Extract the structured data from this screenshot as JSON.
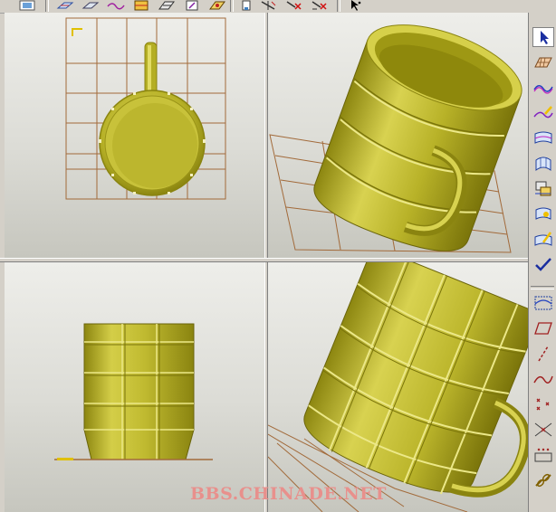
{
  "toolbar": {
    "icons": [
      "view-settings-icon",
      "wireframe-surface-icon",
      "curve-icon",
      "shaded-surface-icon",
      "sweep-surface-icon",
      "sketch-icon",
      "surface-edit-icon",
      "point-icon",
      "trim-icon",
      "delete-icon",
      "delete-all-icon",
      "select-cursor-icon"
    ]
  },
  "viewports": [
    {
      "name": "top-view",
      "view": "top"
    },
    {
      "name": "isometric-view-upper",
      "view": "isometric"
    },
    {
      "name": "front-view",
      "view": "front"
    },
    {
      "name": "isometric-view-lower",
      "view": "isometric"
    }
  ],
  "rightbar": {
    "upper_tools": [
      "select-arrow-icon",
      "plane-icon",
      "curve-wave-icon",
      "curve-edit-icon",
      "surface-icon",
      "loft-surface-icon",
      "surface-copy-icon",
      "surface-offset-icon",
      "surface-edit-icon",
      "confirm-check-icon"
    ],
    "lower_tools": [
      "curve-on-surface-icon",
      "parallelogram-icon",
      "line-icon",
      "spline-icon",
      "points-icon",
      "intersection-points-icon",
      "point-array-icon",
      "chain-icon"
    ]
  },
  "colors": {
    "model_fill": "#b2ad1e",
    "model_highlight": "#e2dd60",
    "grid": "#a26a3a",
    "viewport_bg": "#e8e8e4"
  },
  "watermark": "BBS.CHINADE.NET"
}
